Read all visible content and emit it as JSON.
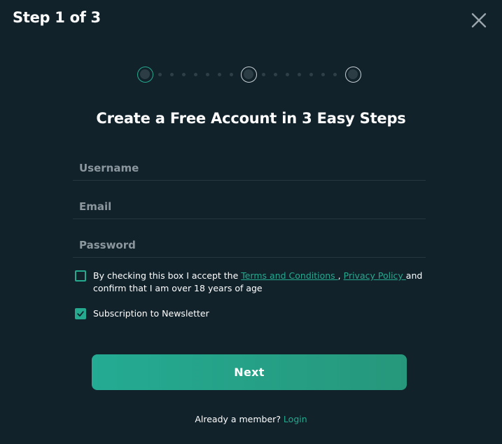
{
  "header": {
    "step_title": "Step 1 of 3"
  },
  "progress": {
    "current_step": 1,
    "total_steps": 3
  },
  "heading": "Create a Free Account in 3 Easy Steps",
  "form": {
    "username_placeholder": "Username",
    "email_placeholder": "Email",
    "password_placeholder": "Password",
    "terms": {
      "checked": false,
      "text_before": "By checking this box I accept the ",
      "terms_link": "Terms and Conditions ",
      "separator": ", ",
      "privacy_link": "Privacy Policy ",
      "text_after": "and confirm that I am over 18 years of age"
    },
    "newsletter": {
      "checked": true,
      "label": "Subscription to Newsletter"
    },
    "next_label": "Next"
  },
  "footer": {
    "prompt": "Already a member? ",
    "login_link": "Login"
  },
  "colors": {
    "background": "#11222b",
    "accent": "#25a98f"
  },
  "icons": {
    "close": "close-icon",
    "checkmark": "checkmark-icon"
  }
}
